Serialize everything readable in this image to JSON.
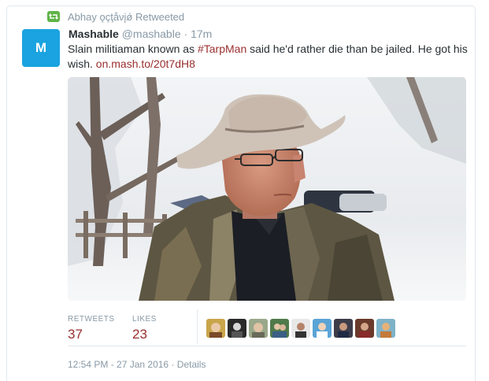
{
  "retweet_context": {
    "icon": "retweet-icon",
    "text": "Abhay ǫçţåνįǿ Retweeted",
    "color": "#5fb447"
  },
  "tweet": {
    "avatar": {
      "icon": "mashable-logo",
      "letter": "M",
      "color": "#1aa3e0"
    },
    "fullname": "Mashable",
    "username": "@mashable",
    "separator": "·",
    "time_ago": "17m",
    "text_before": "Slain militiaman known as ",
    "hashtag": "#TarpMan",
    "text_after": " said he'd rather die than be jailed. He got his wish. ",
    "link": "on.mash.to/20t7dH8",
    "link_color": "#9a2e2e"
  },
  "stats": {
    "retweets_label": "RETWEETS",
    "retweets_count": "37",
    "likes_label": "LIKES",
    "likes_count": "23",
    "liker_avatars": [
      "liker-avatar-1",
      "liker-avatar-2",
      "liker-avatar-3",
      "liker-avatar-4",
      "liker-avatar-5",
      "liker-avatar-6",
      "liker-avatar-7",
      "liker-avatar-8",
      "liker-avatar-9"
    ]
  },
  "footer": {
    "timestamp": "12:54 PM - 27 Jan 2016",
    "separator": "·",
    "details_label": "Details"
  }
}
